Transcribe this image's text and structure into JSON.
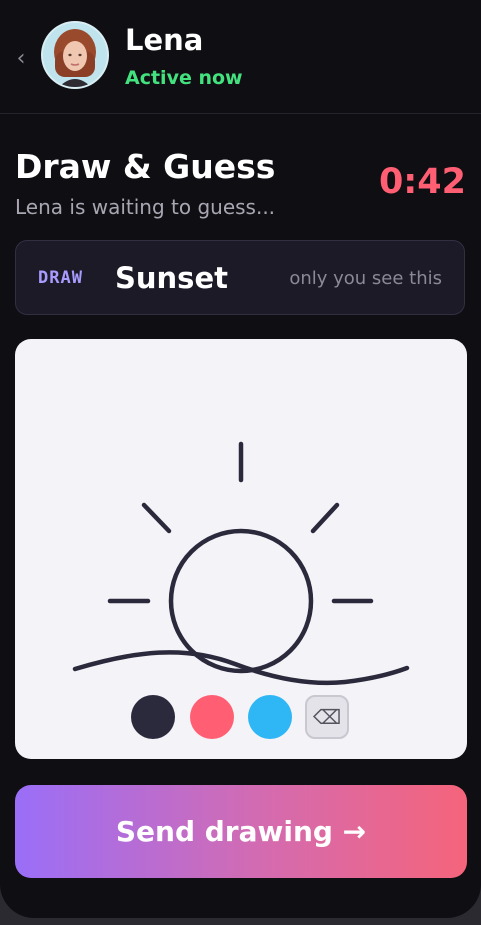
{
  "header": {
    "back_glyph": "‹",
    "contact_name": "Lena",
    "status": "Active now",
    "status_color": "#43e27f"
  },
  "game": {
    "title": "Draw & Guess",
    "subtitle": "Lena is waiting to guess...",
    "timer": "0:42",
    "timer_color": "#ff5e73"
  },
  "word_card": {
    "tag": "DRAW",
    "word": "Sunset",
    "note": "only you see this"
  },
  "palette": {
    "colors": [
      "#2b2a3c",
      "#ff5e73",
      "#2fb6f5"
    ],
    "eraser_glyph": "⌫",
    "eraser_icon": "eraser-icon"
  },
  "drawing_stroke_color": "#2b2a3c",
  "send_button": {
    "label": "Send drawing →"
  },
  "accent": {
    "gradient_start": "#9a6ef8",
    "gradient_end": "#f5647b"
  }
}
